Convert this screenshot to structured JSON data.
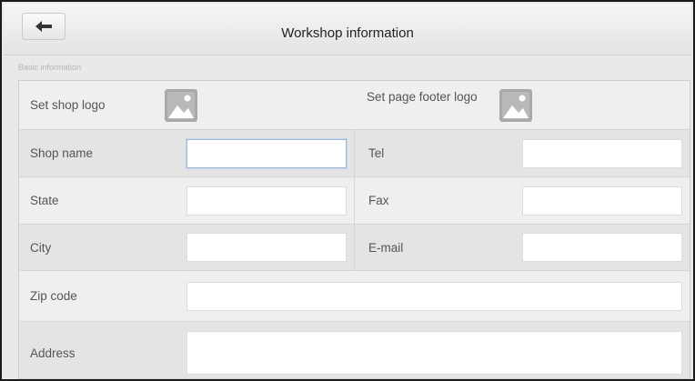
{
  "header": {
    "title": "Workshop information",
    "back_icon": "back-arrow-icon"
  },
  "section": {
    "label": "Basic information"
  },
  "logos": {
    "shop_logo_label": "Set shop logo",
    "footer_logo_label": "Set page footer logo",
    "icon": "image-placeholder-icon"
  },
  "fields": {
    "shop_name": {
      "label": "Shop name",
      "value": ""
    },
    "tel": {
      "label": "Tel",
      "value": ""
    },
    "state": {
      "label": "State",
      "value": ""
    },
    "fax": {
      "label": "Fax",
      "value": ""
    },
    "city": {
      "label": "City",
      "value": ""
    },
    "email": {
      "label": "E-mail",
      "value": ""
    },
    "zip_code": {
      "label": "Zip code",
      "value": ""
    },
    "address": {
      "label": "Address",
      "value": ""
    }
  },
  "colors": {
    "header_bg": "#ececec",
    "form_bg": "#ececec",
    "input_bg": "#ffffff",
    "icon_color": "#a8a8a8",
    "focus_border": "#9fb8d6"
  }
}
